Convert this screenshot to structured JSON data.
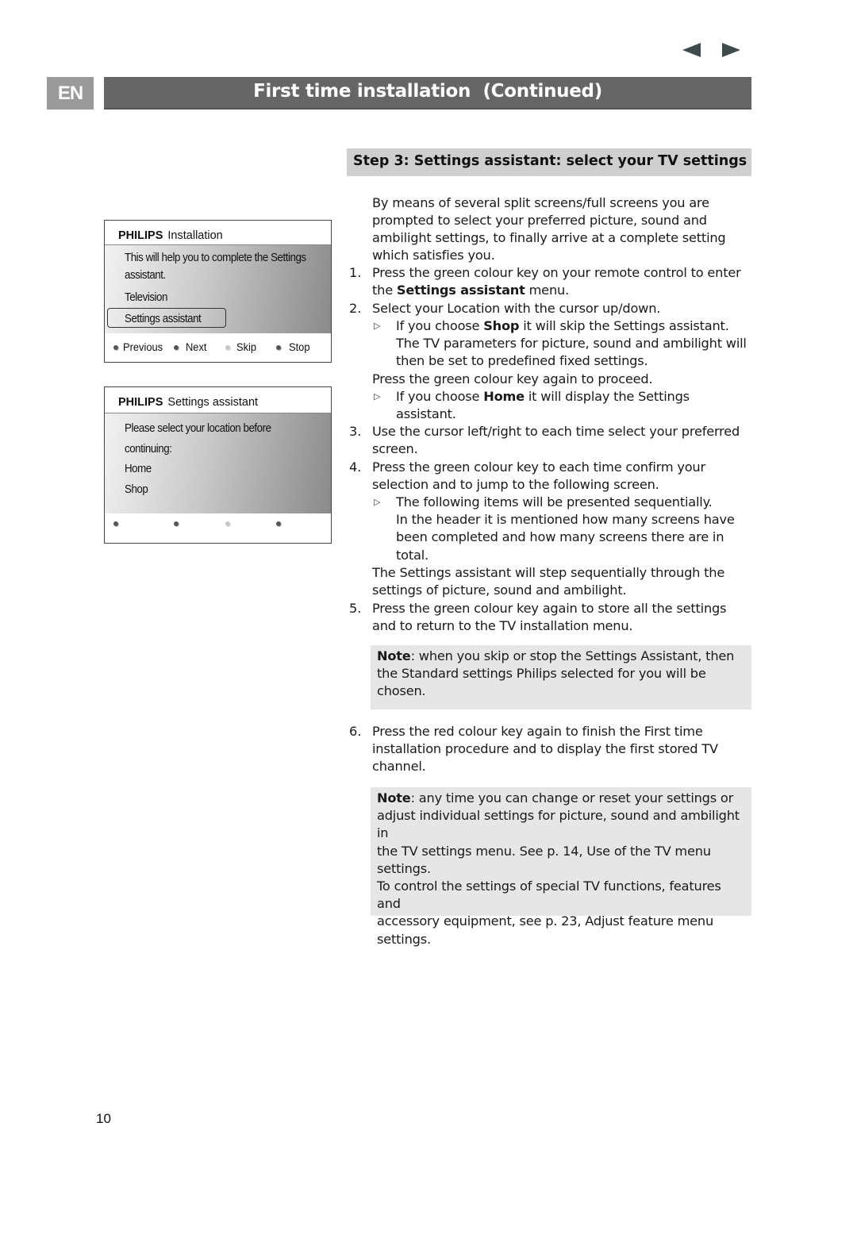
{
  "nav": {
    "prev_icon": "triangle-left",
    "next_icon": "triangle-right"
  },
  "header": {
    "lang": "EN",
    "title": "First time installation  (Continued)"
  },
  "step_heading": "Step 3: Settings assistant: select your TV settings",
  "screen1": {
    "brand": "PHILIPS",
    "title": "Installation",
    "lines": [
      "This will help you to complete the Settings",
      "assistant."
    ],
    "items": [
      "Television",
      "Settings assistant"
    ],
    "selected_item": "Settings assistant",
    "footer": [
      "Previous",
      "Next",
      "Skip",
      "Stop"
    ]
  },
  "screen2": {
    "brand": "PHILIPS",
    "title": "Settings assistant",
    "lines": [
      "Please select your location before",
      "continuing:"
    ],
    "items": [
      "Home",
      "Shop"
    ]
  },
  "intro": [
    "By means of several split screens/full screens you are",
    "prompted to select your preferred picture, sound and",
    "ambilight settings, to finally arrive at a complete setting",
    "which satisfies you."
  ],
  "steps": {
    "s1": {
      "num": "1.",
      "l1": "Press the green colour key on your remote control to enter",
      "l2a": "the ",
      "l2b": "Settings assistant",
      "l2c": " menu."
    },
    "s2": {
      "num": "2.",
      "l1": "Select your Location with the cursor up/down."
    },
    "s2_shop": {
      "a": "If you choose ",
      "b": "Shop",
      "c": " it will skip the Settings assistant.",
      "l2": "The TV parameters for picture, sound and ambilight will",
      "l3": "then be set to predefined fixed settings."
    },
    "s2_proceed": "Press the green colour key again to proceed.",
    "s2_home": {
      "a": "If you choose ",
      "b": "Home",
      "c": " it will display the Settings",
      "l2": "assistant."
    },
    "s3": {
      "num": "3.",
      "l1": "Use the cursor left/right to each time select your preferred",
      "l2": "screen."
    },
    "s4": {
      "num": "4.",
      "l1": "Press the green colour key to each time confirm your",
      "l2": "selection and to jump to the following screen."
    },
    "s4_sub": {
      "l1": "The following items will be presented sequentially.",
      "l2": "In the header it is mentioned how many screens have",
      "l3": "been completed and how many screens there are in",
      "l4": "total."
    },
    "s4_after": {
      "l1": "The Settings assistant will step sequentially through the",
      "l2": "settings of picture, sound and ambilight."
    },
    "s5": {
      "num": "5.",
      "l1": "Press the green colour key again to store all the settings",
      "l2": "and to return to the TV installation menu."
    },
    "s6": {
      "num": "6.",
      "l1": "Press the red colour key again to finish the First time",
      "l2": "installation procedure and to display the first stored TV",
      "l3": "channel."
    }
  },
  "note1": {
    "label": "Note",
    "l1": ": when you skip or stop the Settings Assistant, then",
    "l2": "the Standard settings Philips selected for you will be",
    "l3": "chosen."
  },
  "note2": {
    "label": "Note",
    "l1": ": any time you can change or reset your settings or",
    "l2": "adjust individual settings for picture, sound and ambilight in",
    "l3": "the TV settings menu. See p. 14, Use of the TV menu",
    "l4": "settings.",
    "l5": "To control the settings of special TV functions, features and",
    "l6": "accessory equipment, see p. 23,  Adjust feature menu",
    "l7": "settings."
  },
  "page_number": "10"
}
